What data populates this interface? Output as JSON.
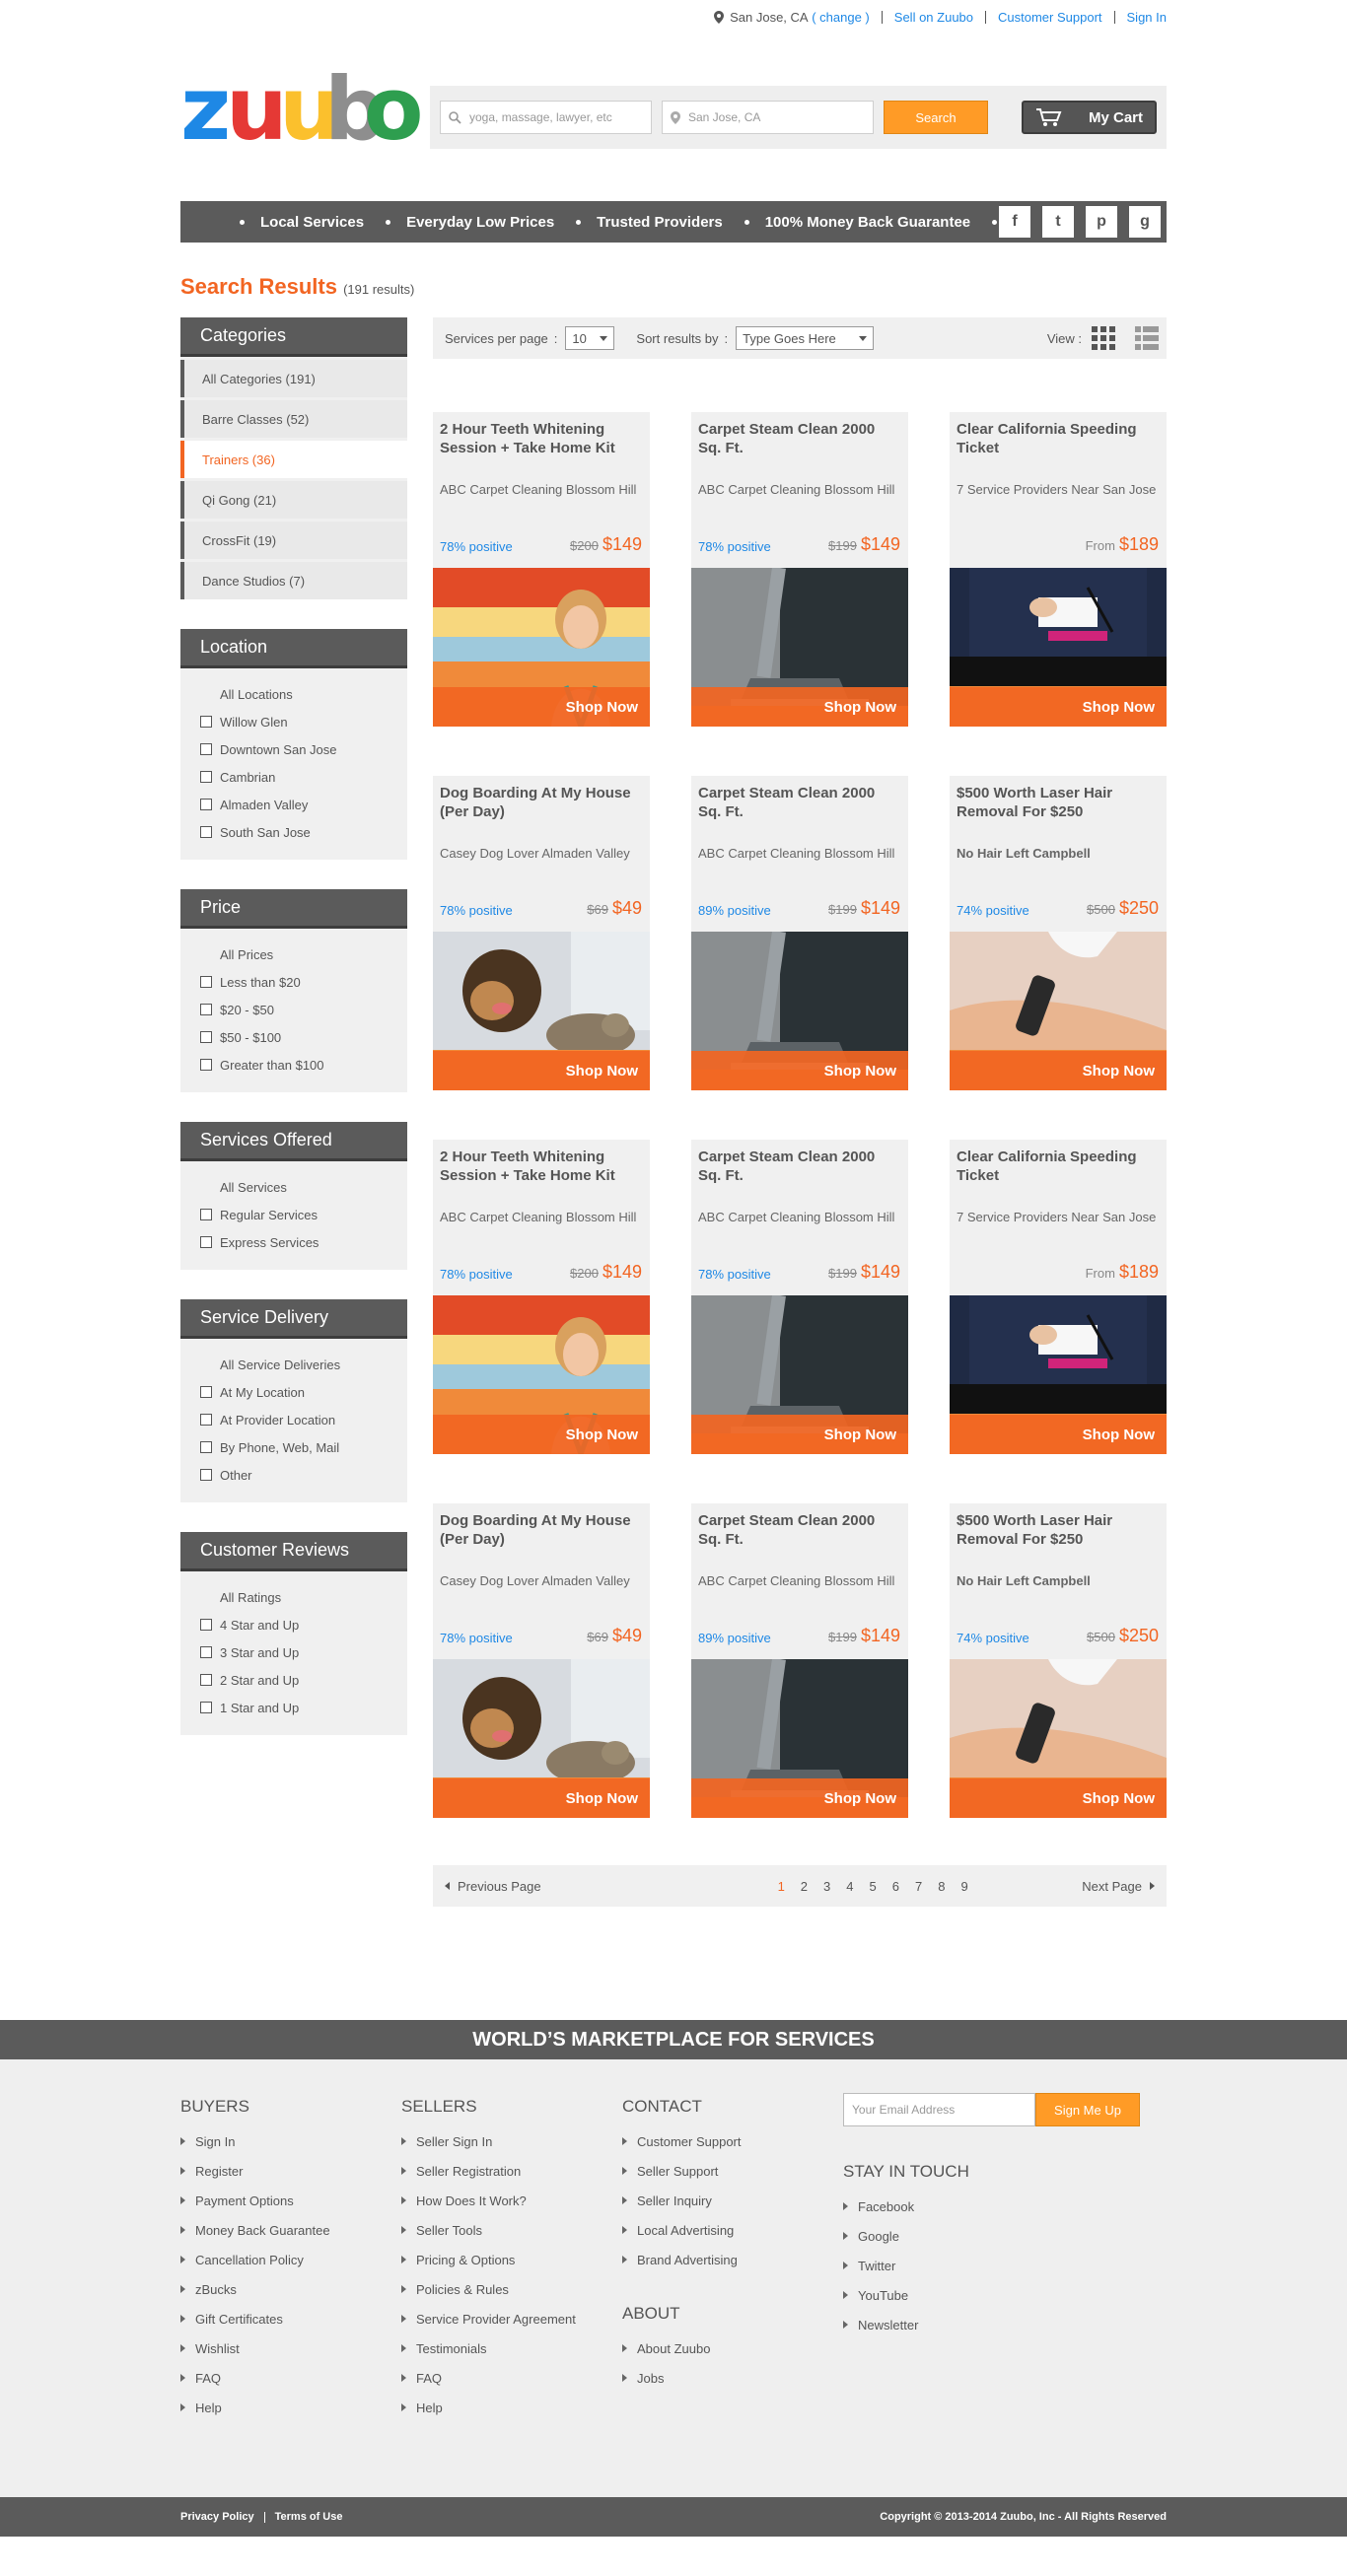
{
  "topbar": {
    "location": "San Jose, CA",
    "change_link": "( change )",
    "sell": "Sell on Zuubo",
    "support": "Customer Support",
    "signin": "Sign In"
  },
  "header": {
    "logo_letters": [
      "z",
      "u",
      "u",
      "b",
      "o"
    ],
    "search_what_placeholder": "yoga, massage, lawyer, etc",
    "search_where_placeholder": "San Jose, CA",
    "search_button": "Search",
    "cart": "My Cart"
  },
  "navbar": {
    "items": [
      "Local Services",
      "Everyday Low Prices",
      "Trusted Providers",
      "100% Money Back Guarantee"
    ],
    "socials": [
      "f",
      "t",
      "p",
      "g"
    ]
  },
  "results": {
    "title": "Search Results",
    "count": "(191 results)"
  },
  "sidebar": {
    "categories": {
      "heading": "Categories",
      "items": [
        {
          "label": "All Categories (191)",
          "active": false
        },
        {
          "label": "Barre Classes  (52)",
          "active": false
        },
        {
          "label": "Trainers  (36)",
          "active": true
        },
        {
          "label": "Qi Gong  (21)",
          "active": false
        },
        {
          "label": "CrossFit  (19)",
          "active": false
        },
        {
          "label": "Dance Studios  (7)",
          "active": false
        }
      ]
    },
    "filters": [
      {
        "heading": "Location",
        "all": "All Locations",
        "options": [
          "Willow Glen",
          "Downtown San Jose",
          "Cambrian",
          "Almaden Valley",
          "South San Jose"
        ]
      },
      {
        "heading": "Price",
        "all": "All Prices",
        "options": [
          "Less than $20",
          "$20 - $50",
          "$50 - $100",
          "Greater than $100"
        ]
      },
      {
        "heading": "Services Offered",
        "all": "All Services",
        "options": [
          "Regular Services",
          "Express Services"
        ]
      },
      {
        "heading": "Service Delivery",
        "all": "All Service Deliveries",
        "options": [
          "At My Location",
          "At Provider Location",
          "By Phone, Web, Mail",
          "Other"
        ]
      },
      {
        "heading": "Customer Reviews",
        "all": "All Ratings",
        "options": [
          "4 Star and Up",
          "3 Star and Up",
          "2 Star and Up",
          "1 Star and Up"
        ]
      }
    ]
  },
  "toolbar": {
    "per_page_label": "Services per page",
    "per_page_value": "10",
    "sort_label": "Sort results by",
    "sort_value": "Type Goes Here",
    "view_label": "View :",
    "colon": ":"
  },
  "cards": [
    {
      "title": "2 Hour Teeth Whitening Session + Take Home Kit",
      "provider": "ABC Carpet Cleaning Blossom Hill",
      "provider_bold": false,
      "rating": "78% positive",
      "old_price": "$200",
      "from": "",
      "price": "$149",
      "image": "woman",
      "shop": "Shop Now"
    },
    {
      "title": "Carpet Steam Clean 2000 Sq. Ft.",
      "provider": "ABC Carpet Cleaning Blossom Hill",
      "provider_bold": false,
      "rating": "78% positive",
      "old_price": "$199",
      "from": "",
      "price": "$149",
      "image": "vacuum",
      "shop": "Shop Now"
    },
    {
      "title": "Clear California Speeding Ticket",
      "provider": "7 Service Providers Near San Jose",
      "provider_bold": false,
      "rating": "",
      "old_price": "",
      "from": "From",
      "price": "$189",
      "image": "police",
      "shop": "Shop Now"
    },
    {
      "title": "Dog Boarding At My House (Per Day)",
      "provider": "Casey Dog Lover Almaden Valley",
      "provider_bold": false,
      "rating": "78% positive",
      "old_price": "$69",
      "from": "",
      "price": "$49",
      "image": "dog",
      "shop": "Shop Now"
    },
    {
      "title": "Carpet Steam Clean 2000 Sq. Ft.",
      "provider": "ABC Carpet Cleaning Blossom Hill",
      "provider_bold": false,
      "rating": "89% positive",
      "old_price": "$199",
      "from": "",
      "price": "$149",
      "image": "vacuum",
      "shop": "Shop Now"
    },
    {
      "title": "$500 Worth Laser Hair Removal For $250",
      "provider": "No Hair Left Campbell",
      "provider_bold": true,
      "rating": "74% positive",
      "old_price": "$500",
      "from": "",
      "price": "$250",
      "image": "laser",
      "shop": "Shop Now"
    },
    {
      "title": "2 Hour Teeth Whitening Session + Take Home Kit",
      "provider": "ABC Carpet Cleaning Blossom Hill",
      "provider_bold": false,
      "rating": "78% positive",
      "old_price": "$200",
      "from": "",
      "price": "$149",
      "image": "woman",
      "shop": "Shop Now"
    },
    {
      "title": "Carpet Steam Clean 2000 Sq. Ft.",
      "provider": "ABC Carpet Cleaning Blossom Hill",
      "provider_bold": false,
      "rating": "78% positive",
      "old_price": "$199",
      "from": "",
      "price": "$149",
      "image": "vacuum",
      "shop": "Shop Now"
    },
    {
      "title": "Clear California Speeding Ticket",
      "provider": "7 Service Providers Near San Jose",
      "provider_bold": false,
      "rating": "",
      "old_price": "",
      "from": "From",
      "price": "$189",
      "image": "police",
      "shop": "Shop Now"
    },
    {
      "title": "Dog Boarding At My House (Per Day)",
      "provider": "Casey Dog Lover Almaden Valley",
      "provider_bold": false,
      "rating": "78% positive",
      "old_price": "$69",
      "from": "",
      "price": "$49",
      "image": "dog",
      "shop": "Shop Now"
    },
    {
      "title": "Carpet Steam Clean 2000 Sq. Ft.",
      "provider": "ABC Carpet Cleaning Blossom Hill",
      "provider_bold": false,
      "rating": "89% positive",
      "old_price": "$199",
      "from": "",
      "price": "$149",
      "image": "vacuum",
      "shop": "Shop Now"
    },
    {
      "title": "$500 Worth Laser Hair Removal For $250",
      "provider": "No Hair Left Campbell",
      "provider_bold": true,
      "rating": "74% positive",
      "old_price": "$500",
      "from": "",
      "price": "$250",
      "image": "laser",
      "shop": "Shop Now"
    }
  ],
  "pager": {
    "prev": "Previous Page",
    "next": "Next Page",
    "pages": [
      "1",
      "2",
      "3",
      "4",
      "5",
      "6",
      "7",
      "8",
      "9"
    ],
    "current": "1"
  },
  "footer": {
    "band": "WORLD’S MARKETPLACE FOR SERVICES",
    "buyers": {
      "heading": "BUYERS",
      "links": [
        "Sign In",
        "Register",
        "Payment Options",
        "Money Back Guarantee",
        "Cancellation Policy",
        "zBucks",
        "Gift Certificates",
        "Wishlist",
        "FAQ",
        "Help"
      ]
    },
    "sellers": {
      "heading": "SELLERS",
      "links": [
        "Seller Sign In",
        "Seller Registration",
        "How Does It Work?",
        "Seller Tools",
        "Pricing & Options",
        "Policies & Rules",
        "Service Provider Agreement",
        "Testimonials",
        "FAQ",
        "Help"
      ]
    },
    "contact": {
      "heading": "CONTACT",
      "links": [
        "Customer Support",
        "Seller Support",
        "Seller Inquiry",
        "Local Advertising",
        "Brand Advertising"
      ]
    },
    "about": {
      "heading": "ABOUT",
      "links": [
        "About Zuubo",
        "Jobs"
      ]
    },
    "newsletter": {
      "placeholder": "Your Email Address",
      "button": "Sign Me Up"
    },
    "stay": {
      "heading": "STAY IN TOUCH",
      "links": [
        "Facebook",
        "Google",
        "Twitter",
        "YouTube",
        "Newsletter"
      ]
    },
    "privacy": "Privacy Policy",
    "terms": "Terms of Use",
    "copyright": "Copyright © 2013-2014 Zuubo, Inc - All Rights Reserved"
  },
  "colors": {
    "accent": "#f26522",
    "button": "#ff9b26",
    "link": "#1e88e5",
    "dark": "#5b5b5b",
    "logo": [
      "#1e88e5",
      "#e53935",
      "#fbc02d",
      "#8e8e8e",
      "#2e9e4f"
    ]
  }
}
